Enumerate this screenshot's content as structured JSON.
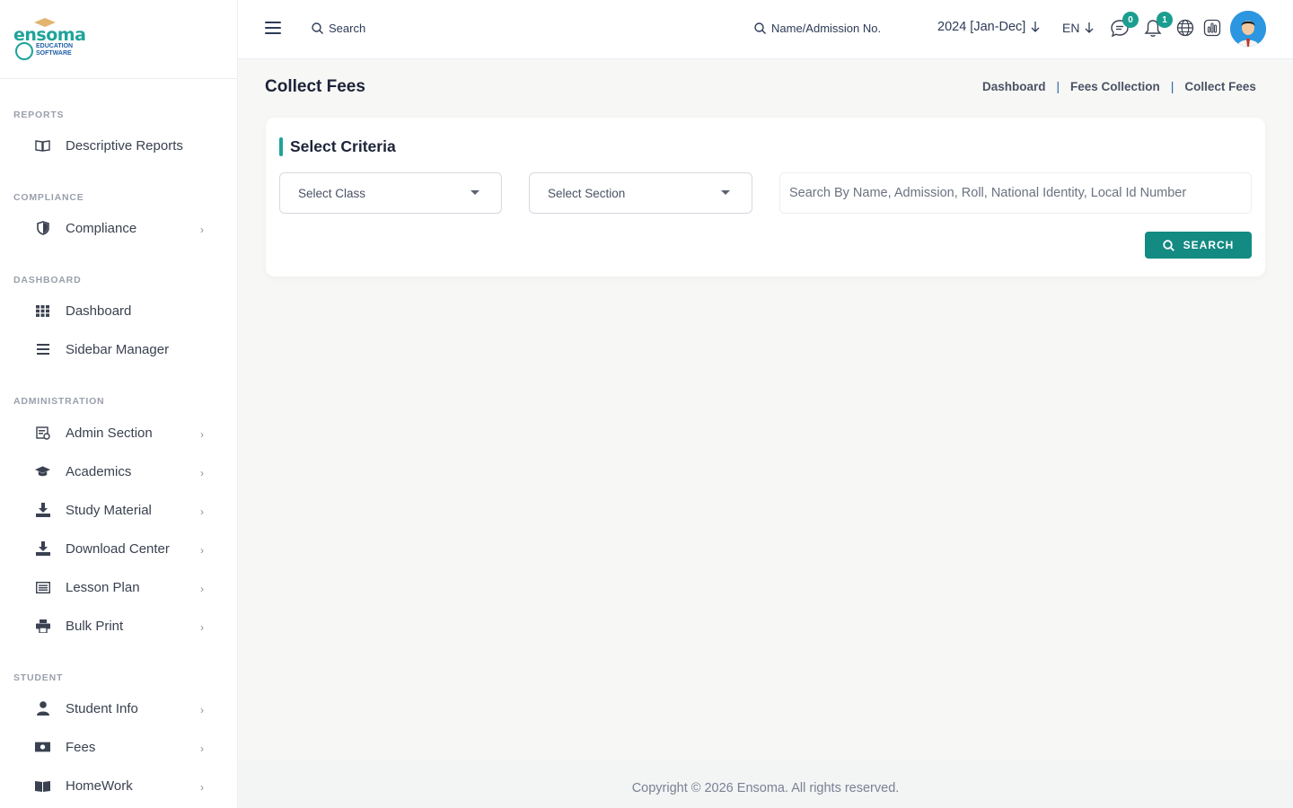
{
  "logo": {
    "word": "ensoma",
    "sub1": "EDUCATION",
    "sub2": "SOFTWARE"
  },
  "sidebar": {
    "sections": [
      {
        "label": "REPORTS"
      },
      {
        "label": "COMPLIANCE"
      },
      {
        "label": "DASHBOARD"
      },
      {
        "label": "ADMINISTRATION"
      },
      {
        "label": "STUDENT"
      }
    ],
    "items": [
      {
        "label": "Descriptive Reports",
        "icon": "book-open-icon",
        "chevron": false
      },
      {
        "label": "Compliance",
        "icon": "shield-icon",
        "chevron": true
      },
      {
        "label": "Dashboard",
        "icon": "grid-icon",
        "chevron": false
      },
      {
        "label": "Sidebar Manager",
        "icon": "bars-icon",
        "chevron": false
      },
      {
        "label": "Admin Section",
        "icon": "admin-icon",
        "chevron": true
      },
      {
        "label": "Academics",
        "icon": "graduation-cap-icon",
        "chevron": true
      },
      {
        "label": "Study Material",
        "icon": "download-icon",
        "chevron": true
      },
      {
        "label": "Download Center",
        "icon": "download-icon",
        "chevron": true
      },
      {
        "label": "Lesson Plan",
        "icon": "list-icon",
        "chevron": true
      },
      {
        "label": "Bulk Print",
        "icon": "printer-icon",
        "chevron": true
      },
      {
        "label": "Student Info",
        "icon": "user-icon",
        "chevron": true
      },
      {
        "label": "Fees",
        "icon": "money-icon",
        "chevron": true
      },
      {
        "label": "HomeWork",
        "icon": "book-icon",
        "chevron": true
      }
    ]
  },
  "topbar": {
    "search_label": "Search",
    "name_search_label": "Name/Admission No.",
    "session": "2024 [Jan-Dec]",
    "language": "EN",
    "messages_count": "0",
    "notifications_count": "1"
  },
  "page": {
    "title": "Collect Fees",
    "breadcrumb": [
      "Dashboard",
      "Fees Collection",
      "Collect Fees"
    ],
    "breadcrumb_sep": "|"
  },
  "criteria": {
    "title": "Select Criteria",
    "class_select": "Select Class",
    "section_select": "Select Section",
    "search_placeholder": "Search By Name, Admission, Roll, National Identity, Local Id Number",
    "search_button": "SEARCH"
  },
  "footer": {
    "copyright": "Copyright © 2026 Ensoma. All rights reserved."
  },
  "colors": {
    "accent": "#138a82",
    "brand_teal": "#1fa39a",
    "text_dark": "#1d2338"
  }
}
